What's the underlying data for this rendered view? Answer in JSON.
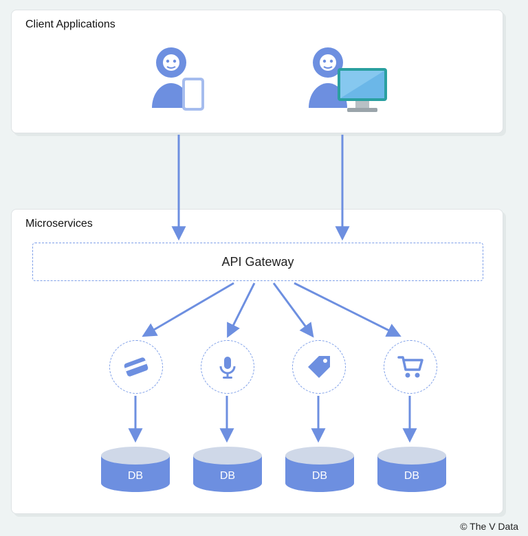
{
  "panels": {
    "clients": {
      "title": "Client Applications"
    },
    "microservices": {
      "title": "Microservices"
    }
  },
  "gateway": {
    "label": "API Gateway"
  },
  "services": [
    {
      "icon": "card-icon"
    },
    {
      "icon": "mic-icon"
    },
    {
      "icon": "tag-icon"
    },
    {
      "icon": "cart-icon"
    }
  ],
  "db_label": "DB",
  "copyright": "© The V Data",
  "colors": {
    "accent": "#6d8fe0",
    "accent_light": "#86a4e8",
    "dashed": "#7d9ee8",
    "db_top": "#cfd8e8"
  }
}
